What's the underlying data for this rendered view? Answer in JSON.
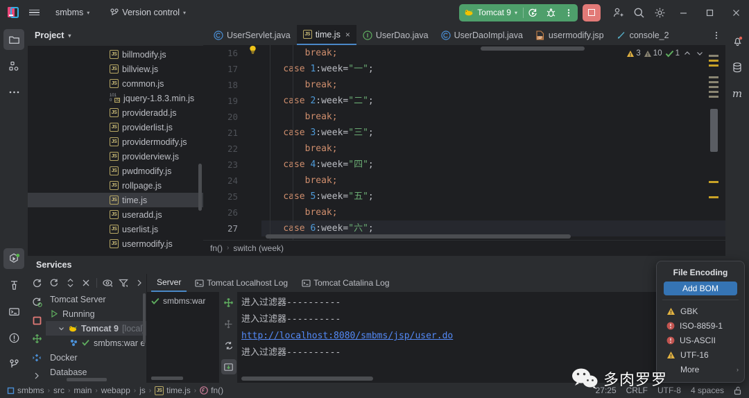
{
  "titlebar": {
    "project_name": "smbms",
    "version_control": "Version control",
    "run_config": "Tomcat 9",
    "icons": {
      "app_logo": "intellij-idea-logo",
      "menu": "hamburger-menu-icon",
      "vcs": "branch-icon",
      "rerun": "rerun-icon",
      "debug": "debug-icon",
      "more": "more-vertical-icon",
      "stop": "stop-icon",
      "account": "add-account-icon",
      "search": "search-icon",
      "settings": "gear-icon",
      "minimize": "minimize-icon",
      "maximize": "maximize-icon",
      "close": "close-icon"
    },
    "colors": {
      "run_green": "#4e9f6b",
      "stop_red": "#e27a77"
    }
  },
  "left_stripe": [
    {
      "name": "project",
      "icon": "folder-icon",
      "active": true
    },
    {
      "name": "structure",
      "icon": "structure-icon",
      "active": false
    },
    {
      "name": "more-tool-windows",
      "icon": "more-horizontal-icon",
      "active": false
    },
    {
      "name": "services",
      "icon": "services-run-icon",
      "active": true
    },
    {
      "name": "build",
      "icon": "hammer-icon",
      "active": false
    },
    {
      "name": "terminal",
      "icon": "terminal-icon",
      "active": false
    },
    {
      "name": "problems",
      "icon": "warning-circle-icon",
      "active": false
    },
    {
      "name": "version-control",
      "icon": "branch-icon",
      "active": false
    }
  ],
  "right_stripe": [
    {
      "name": "notifications",
      "icon": "bell-icon",
      "badge": true
    },
    {
      "name": "database",
      "icon": "database-icon",
      "badge": false
    },
    {
      "name": "maven",
      "icon": "maven-m-icon",
      "badge": false
    }
  ],
  "project_panel": {
    "title": "Project",
    "files": [
      {
        "label": "billmodify.js",
        "icon": "js-file-icon",
        "selected": false
      },
      {
        "label": "billview.js",
        "icon": "js-file-icon",
        "selected": false
      },
      {
        "label": "common.js",
        "icon": "js-file-icon",
        "selected": false
      },
      {
        "label": "jquery-1.8.3.min.js",
        "icon": "js-min-file-icon",
        "selected": false
      },
      {
        "label": "provideradd.js",
        "icon": "js-file-icon",
        "selected": false
      },
      {
        "label": "providerlist.js",
        "icon": "js-file-icon",
        "selected": false
      },
      {
        "label": "providermodify.js",
        "icon": "js-file-icon",
        "selected": false
      },
      {
        "label": "providerview.js",
        "icon": "js-file-icon",
        "selected": false
      },
      {
        "label": "pwdmodify.js",
        "icon": "js-file-icon",
        "selected": false
      },
      {
        "label": "rollpage.js",
        "icon": "js-file-icon",
        "selected": false
      },
      {
        "label": "time.js",
        "icon": "js-file-icon",
        "selected": true
      },
      {
        "label": "useradd.js",
        "icon": "js-file-icon",
        "selected": false
      },
      {
        "label": "userlist.js",
        "icon": "js-file-icon",
        "selected": false
      },
      {
        "label": "usermodify.js",
        "icon": "js-file-icon",
        "selected": false
      }
    ]
  },
  "editor": {
    "tabs": [
      {
        "label": "UserServlet.java",
        "icon": "java-class-icon",
        "active": false,
        "closable": false
      },
      {
        "label": "time.js",
        "icon": "js-file-icon",
        "active": true,
        "closable": true
      },
      {
        "label": "UserDao.java",
        "icon": "java-interface-icon",
        "active": false,
        "closable": false
      },
      {
        "label": "UserDaoImpl.java",
        "icon": "java-class-icon",
        "active": false,
        "closable": false
      },
      {
        "label": "usermodify.jsp",
        "icon": "jsp-file-icon",
        "active": false,
        "closable": false
      },
      {
        "label": "console_2",
        "icon": "scratch-file-icon",
        "active": false,
        "closable": false
      }
    ],
    "close_label": "×",
    "inspection_widget": {
      "warnings": "3",
      "weak_warnings": "10",
      "oks": "1",
      "prev_icon": "chevron-up-icon",
      "next_icon": "chevron-down-icon"
    },
    "lines": [
      {
        "no": "16",
        "indent": 8,
        "kw": "",
        "mid": "",
        "str": "",
        "tail": "break;",
        "type": "break",
        "current": false,
        "bulb": false
      },
      {
        "no": "17",
        "indent": 4,
        "kw": "case",
        "num": "1",
        "mid": ":week=",
        "str": "\"一\"",
        "tail": ";",
        "type": "case",
        "current": false,
        "bulb": false
      },
      {
        "no": "18",
        "indent": 8,
        "tail": "break;",
        "type": "break",
        "current": false,
        "bulb": false
      },
      {
        "no": "19",
        "indent": 4,
        "kw": "case",
        "num": "2",
        "mid": ":week=",
        "str": "\"二\"",
        "tail": ";",
        "type": "case",
        "current": false,
        "bulb": false
      },
      {
        "no": "20",
        "indent": 8,
        "tail": "break;",
        "type": "break",
        "current": false,
        "bulb": false
      },
      {
        "no": "21",
        "indent": 4,
        "kw": "case",
        "num": "3",
        "mid": ":week=",
        "str": "\"三\"",
        "tail": ";",
        "type": "case",
        "current": false,
        "bulb": false
      },
      {
        "no": "22",
        "indent": 8,
        "tail": "break;",
        "type": "break",
        "current": false,
        "bulb": false
      },
      {
        "no": "23",
        "indent": 4,
        "kw": "case",
        "num": "4",
        "mid": ":week=",
        "str": "\"四\"",
        "tail": ";",
        "type": "case",
        "current": false,
        "bulb": false
      },
      {
        "no": "24",
        "indent": 8,
        "tail": "break;",
        "type": "break",
        "current": false,
        "bulb": false
      },
      {
        "no": "25",
        "indent": 4,
        "kw": "case",
        "num": "5",
        "mid": ":week=",
        "str": "\"五\"",
        "tail": ";",
        "type": "case",
        "current": false,
        "bulb": false
      },
      {
        "no": "26",
        "indent": 8,
        "tail": "break;",
        "type": "break",
        "current": false,
        "bulb": false
      },
      {
        "no": "27",
        "indent": 4,
        "kw": "case",
        "num": "6",
        "mid": ":week=",
        "str": "\"六\"",
        "tail": ";",
        "type": "case",
        "current": true,
        "bulb": true
      }
    ],
    "breadcrumb": [
      "fn()",
      "switch (week)"
    ],
    "breadcrumb_sep": "›"
  },
  "services": {
    "title": "Services",
    "toolbar_icons": [
      "rerun-icon",
      "expand-collapse-icon",
      "close-icon",
      "show-icon",
      "filter-icon",
      "chevron-right-icon"
    ],
    "vtoolbar_icons": [
      "refresh-icon",
      "rerun-debug-icon",
      "stop-icon",
      "deploy-icon",
      "sort-icon",
      "chevron-right-icon"
    ],
    "tree": [
      {
        "label": "Tomcat Server",
        "indent": 0,
        "icon": "",
        "selected": false,
        "suffix": ""
      },
      {
        "label": "Running",
        "indent": 0,
        "icon": "run-triangle-icon",
        "selected": false,
        "suffix": ""
      },
      {
        "label": "Tomcat 9",
        "indent": 1,
        "icon": "tomcat-icon",
        "selected": true,
        "suffix": "[local]"
      },
      {
        "label": "smbms:war e",
        "indent": 2,
        "icon": "artifact-check-icon",
        "selected": false,
        "suffix": ""
      },
      {
        "label": "Docker",
        "indent": 0,
        "icon": "",
        "selected": false,
        "suffix": ""
      },
      {
        "label": "Database",
        "indent": 0,
        "icon": "",
        "selected": false,
        "suffix": ""
      }
    ],
    "log_tabs": [
      {
        "label": "Server",
        "icon": "",
        "active": true
      },
      {
        "label": "Tomcat Localhost Log",
        "icon": "console-icon",
        "active": false
      },
      {
        "label": "Tomcat Catalina Log",
        "icon": "console-icon",
        "active": false
      }
    ],
    "deployments": [
      {
        "label": "smbms:war",
        "icon": "green-check-icon"
      }
    ],
    "deploy_tools": [
      "deploy-icon",
      "undeploy-icon",
      "redeploy-icon",
      "update-icon"
    ],
    "console_lines": [
      {
        "text": "进入过滤器----------",
        "link": false
      },
      {
        "text": "http://localhost:8080/smbms/jsp/user.do",
        "link": true
      },
      {
        "text": "进入过滤器----------",
        "link": false
      },
      {
        "text": "进入过滤器----------",
        "link": false
      }
    ]
  },
  "encoding_popup": {
    "title": "File Encoding",
    "add_bom": "Add BOM",
    "options": [
      {
        "label": "GBK",
        "severity": "warning"
      },
      {
        "label": "ISO-8859-1",
        "severity": "error"
      },
      {
        "label": "US-ASCII",
        "severity": "error"
      },
      {
        "label": "UTF-16",
        "severity": "warning"
      },
      {
        "label": "More",
        "severity": "none",
        "has_more": true
      }
    ],
    "more_arrow": "›"
  },
  "watermark": {
    "text": "多肉罗罗",
    "icon": "wechat-icon"
  },
  "status_bar": {
    "breadcrumbs": [
      {
        "label": "smbms",
        "icon": "module-icon"
      },
      {
        "label": "src",
        "icon": ""
      },
      {
        "label": "main",
        "icon": ""
      },
      {
        "label": "webapp",
        "icon": ""
      },
      {
        "label": "js",
        "icon": ""
      },
      {
        "label": "time.js",
        "icon": "js-file-icon"
      },
      {
        "label": "fn()",
        "icon": "function-icon"
      }
    ],
    "separator": "›",
    "caret": "27:25",
    "line_sep": "CRLF",
    "encoding": "UTF-8",
    "indent": "4 spaces",
    "lock_icon": "unlocked-icon"
  }
}
